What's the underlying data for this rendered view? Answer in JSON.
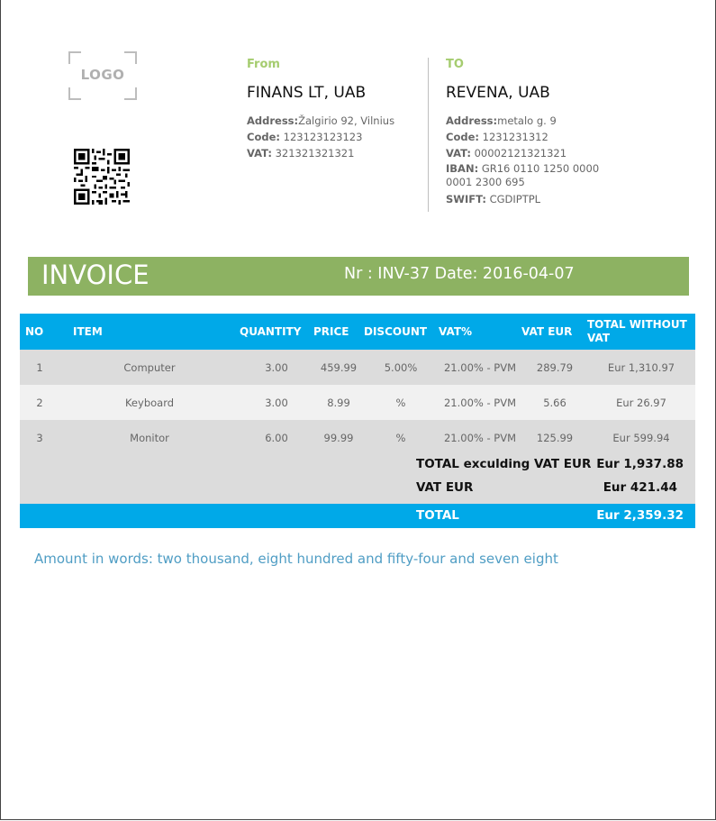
{
  "logo": {
    "text": "LOGO"
  },
  "from": {
    "heading": "From",
    "name": "FINANS LT, UAB",
    "address_label": "Address:",
    "address": "Žalgirio 92, Vilnius",
    "code_label": "Code:",
    "code": "123123123123",
    "vat_label": "VAT:",
    "vat": "321321321321"
  },
  "to": {
    "heading": "TO",
    "name": "REVENA, UAB",
    "address_label": "Address:",
    "address": "metalo g. 9",
    "code_label": "Code:",
    "code": "1231231312",
    "vat_label": "VAT:",
    "vat": "00002121321321",
    "iban_label": "IBAN:",
    "iban": "GR16 0110 1250 0000 0001 2300 695",
    "swift_label": "SWIFT:",
    "swift": "CGDIPTPL"
  },
  "banner": {
    "title": "INVOICE",
    "meta": "Nr : INV-37  Date: 2016-04-07"
  },
  "table": {
    "headers": [
      "NO",
      "ITEM",
      "QUANTITY",
      "PRICE",
      "DISCOUNT",
      "VAT%",
      "VAT EUR",
      "TOTAL WITHOUT VAT"
    ],
    "rows": [
      [
        "1",
        "Computer",
        "3.00",
        "459.99",
        "5.00%",
        "21.00% - PVM",
        "289.79",
        "Eur  1,310.97"
      ],
      [
        "2",
        "Keyboard",
        "3.00",
        "8.99",
        "%",
        "21.00% - PVM",
        "5.66",
        "Eur  26.97"
      ],
      [
        "3",
        "Monitor",
        "6.00",
        "99.99",
        "%",
        "21.00% - PVM",
        "125.99",
        "Eur  599.94"
      ]
    ],
    "totals": {
      "without_vat_label": "TOTAL exculding VAT EUR",
      "without_vat_value": "Eur  1,937.88",
      "vat_label": "VAT EUR",
      "vat_value": "Eur  421.44",
      "total_label": "TOTAL",
      "total_value": "Eur  2,359.32"
    }
  },
  "amount_in_words": "Amount in words: two thousand, eight hundred and fifty-four and seven eight",
  "colors": {
    "green": "#8db262",
    "blue": "#00a9e8",
    "light_green": "#a5cc6f",
    "words": "#4f9dc4"
  }
}
